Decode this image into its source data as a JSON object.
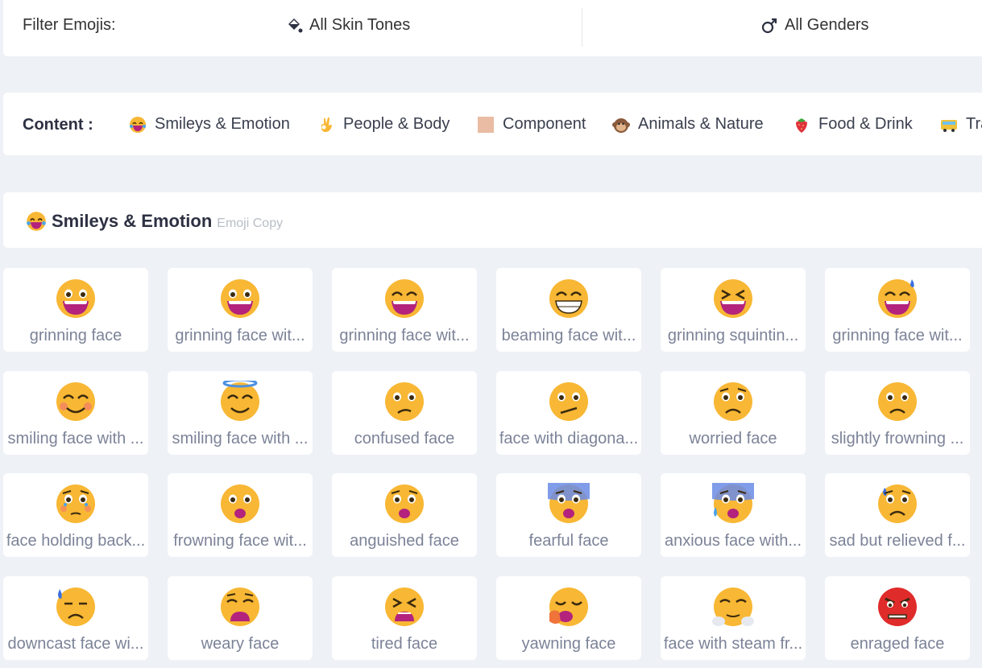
{
  "filter": {
    "label": "Filter Emojis:",
    "skin_tones": "All Skin Tones",
    "genders": "All Genders"
  },
  "content": {
    "label": "Content :",
    "categories": [
      {
        "label": "Smileys & Emotion",
        "icon": "laughing-face-icon"
      },
      {
        "label": "People & Body",
        "icon": "ok-hand-icon"
      },
      {
        "label": "Component",
        "icon": "skin-swatch-icon"
      },
      {
        "label": "Animals & Nature",
        "icon": "monkey-face-icon"
      },
      {
        "label": "Food & Drink",
        "icon": "strawberry-icon"
      },
      {
        "label": "Tra",
        "icon": "bus-icon"
      }
    ]
  },
  "section": {
    "title": "Smileys & Emotion",
    "subtitle": "Emoji Copy",
    "icon": "laughing-face-icon"
  },
  "emojis": [
    {
      "name": "grinning face",
      "icon": "grinning-face-icon"
    },
    {
      "name": "grinning face wit...",
      "icon": "grinning-face-big-eyes-icon"
    },
    {
      "name": "grinning face wit...",
      "icon": "grinning-face-smiling-eyes-icon"
    },
    {
      "name": "beaming face wit...",
      "icon": "beaming-face-icon"
    },
    {
      "name": "grinning squintin...",
      "icon": "grinning-squinting-face-icon"
    },
    {
      "name": "grinning face wit...",
      "icon": "grinning-face-sweat-icon"
    },
    {
      "name": "smiling face with ...",
      "icon": "smiling-face-smiling-eyes-icon"
    },
    {
      "name": "smiling face with ...",
      "icon": "smiling-face-halo-icon"
    },
    {
      "name": "confused face",
      "icon": "confused-face-icon"
    },
    {
      "name": "face with diagona...",
      "icon": "diagonal-mouth-face-icon"
    },
    {
      "name": "worried face",
      "icon": "worried-face-icon"
    },
    {
      "name": "slightly frowning ...",
      "icon": "slightly-frowning-face-icon"
    },
    {
      "name": "face holding back...",
      "icon": "holding-back-tears-icon"
    },
    {
      "name": "frowning face wit...",
      "icon": "frowning-open-mouth-icon"
    },
    {
      "name": "anguished face",
      "icon": "anguished-face-icon"
    },
    {
      "name": "fearful face",
      "icon": "fearful-face-icon"
    },
    {
      "name": "anxious face with...",
      "icon": "anxious-sweat-face-icon"
    },
    {
      "name": "sad but relieved f...",
      "icon": "sad-relieved-face-icon"
    },
    {
      "name": "downcast face wi...",
      "icon": "downcast-sweat-face-icon"
    },
    {
      "name": "weary face",
      "icon": "weary-face-icon"
    },
    {
      "name": "tired face",
      "icon": "tired-face-icon"
    },
    {
      "name": "yawning face",
      "icon": "yawning-face-icon"
    },
    {
      "name": "face with steam fr...",
      "icon": "steam-nose-face-icon"
    },
    {
      "name": "enraged face",
      "icon": "enraged-face-icon"
    }
  ],
  "colors": {
    "background": "#eef1f5",
    "card": "#ffffff",
    "emoji_yellow": "#f8b734",
    "emoji_mouth": "#b3227d",
    "enraged_red": "#e02b2b",
    "label_gray": "#7c8398"
  }
}
